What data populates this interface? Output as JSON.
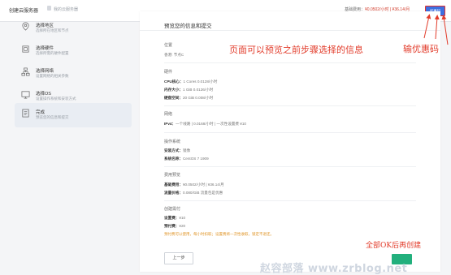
{
  "header": {
    "app_title": "创建云服务器",
    "breadcrumb": "我的云服务器",
    "fee_label": "基础费用：",
    "fee_value": "¥0.0502/小时 | ¥36.14/月",
    "promo_button": "优惠码"
  },
  "sidebar": {
    "steps": [
      {
        "title": "选择地区",
        "desc": "选择所在地区和节点",
        "icon": "location-icon"
      },
      {
        "title": "选择硬件",
        "desc": "选择所需的硬件配置",
        "icon": "cpu-icon"
      },
      {
        "title": "选择网络",
        "desc": "设置网络的相关参数",
        "icon": "network-icon"
      },
      {
        "title": "选择OS",
        "desc": "设置操作系统和安装方式",
        "icon": "monitor-icon"
      },
      {
        "title": "完成",
        "desc": "预览您的信息和提交",
        "icon": "checklist-icon"
      }
    ],
    "active_index": 4
  },
  "main": {
    "title": "预览您的信息和提交",
    "sections": {
      "location": {
        "title": "位置",
        "value": "香港: 节点C"
      },
      "hardware": {
        "title": "硬件",
        "cpu_k": "CPU核心：",
        "cpu_v": "1 Cores 0.0128/小时",
        "mem_k": "内存大小：",
        "mem_v": "1 GiB 0.0126/小时",
        "disk_k": "硬盘空间：",
        "disk_v": "20 GiB 0.008/小时"
      },
      "network": {
        "title": "网络",
        "ipv4_k": "IPv4：",
        "ipv4_v": "一个线路 | 0.0168/小时 | 一次性设置费 ¥10"
      },
      "os": {
        "title": "操作系统",
        "install_k": "安装方式：",
        "install_v": "镜像",
        "name_k": "系统名称：",
        "name_v": "CentOS 7 1909"
      },
      "fees": {
        "title": "费用预览",
        "base_k": "基础费用：",
        "base_v": "¥0.0502/小时 | ¥36.14/月",
        "traffic_k": "流量价格：",
        "traffic_v": "0.080/GiB 流量包是优惠"
      },
      "create": {
        "title": "创建需付",
        "setup_k": "设置费：",
        "setup_v": "¥10",
        "prepay_k": "预付费：",
        "prepay_v": "¥20",
        "note": "预付费可以使用，每小时扣取；设置费将一次性收取，锁定不退还。"
      }
    },
    "prev_button": "上一步"
  },
  "annotations": {
    "preview_note": "页面可以预览之前步骤选择的信息",
    "promo_note": "输优惠码",
    "create_note": "全部OK后再创建"
  },
  "watermark": "赵容部落 www.zrblog.net",
  "colors": {
    "accent": "#3d6fe0",
    "annotation": "#e23c2b",
    "create_button": "#22b07d",
    "warning": "#e0962a"
  }
}
